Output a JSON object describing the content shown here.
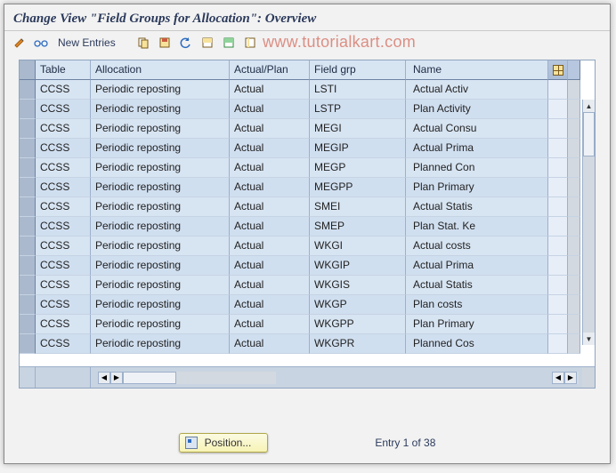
{
  "title": "Change View \"Field Groups for Allocation\": Overview",
  "watermark": "www.tutorialkart.com",
  "toolbar": {
    "new_entries": "New Entries"
  },
  "columns": {
    "c1": "Table",
    "c2": "Allocation",
    "c3": "Actual/Plan",
    "c4": "Field grp",
    "c5": "Name"
  },
  "rows": [
    {
      "table": "CCSS",
      "alloc": "Periodic reposting",
      "ap": "Actual",
      "fg": "LSTI",
      "name": "Actual Activ"
    },
    {
      "table": "CCSS",
      "alloc": "Periodic reposting",
      "ap": "Actual",
      "fg": "LSTP",
      "name": "Plan Activity"
    },
    {
      "table": "CCSS",
      "alloc": "Periodic reposting",
      "ap": "Actual",
      "fg": "MEGI",
      "name": "Actual Consu"
    },
    {
      "table": "CCSS",
      "alloc": "Periodic reposting",
      "ap": "Actual",
      "fg": "MEGIP",
      "name": "Actual Prima"
    },
    {
      "table": "CCSS",
      "alloc": "Periodic reposting",
      "ap": "Actual",
      "fg": "MEGP",
      "name": "Planned Con"
    },
    {
      "table": "CCSS",
      "alloc": "Periodic reposting",
      "ap": "Actual",
      "fg": "MEGPP",
      "name": "Plan Primary"
    },
    {
      "table": "CCSS",
      "alloc": "Periodic reposting",
      "ap": "Actual",
      "fg": "SMEI",
      "name": "Actual Statis"
    },
    {
      "table": "CCSS",
      "alloc": "Periodic reposting",
      "ap": "Actual",
      "fg": "SMEP",
      "name": "Plan Stat. Ke"
    },
    {
      "table": "CCSS",
      "alloc": "Periodic reposting",
      "ap": "Actual",
      "fg": "WKGI",
      "name": "Actual costs"
    },
    {
      "table": "CCSS",
      "alloc": "Periodic reposting",
      "ap": "Actual",
      "fg": "WKGIP",
      "name": "Actual Prima"
    },
    {
      "table": "CCSS",
      "alloc": "Periodic reposting",
      "ap": "Actual",
      "fg": "WKGIS",
      "name": "Actual Statis"
    },
    {
      "table": "CCSS",
      "alloc": "Periodic reposting",
      "ap": "Actual",
      "fg": "WKGP",
      "name": "Plan costs"
    },
    {
      "table": "CCSS",
      "alloc": "Periodic reposting",
      "ap": "Actual",
      "fg": "WKGPP",
      "name": "Plan Primary"
    },
    {
      "table": "CCSS",
      "alloc": "Periodic reposting",
      "ap": "Actual",
      "fg": "WKGPR",
      "name": "Planned Cos"
    }
  ],
  "footer": {
    "position_btn": "Position...",
    "entry_text": "Entry 1 of 38"
  }
}
